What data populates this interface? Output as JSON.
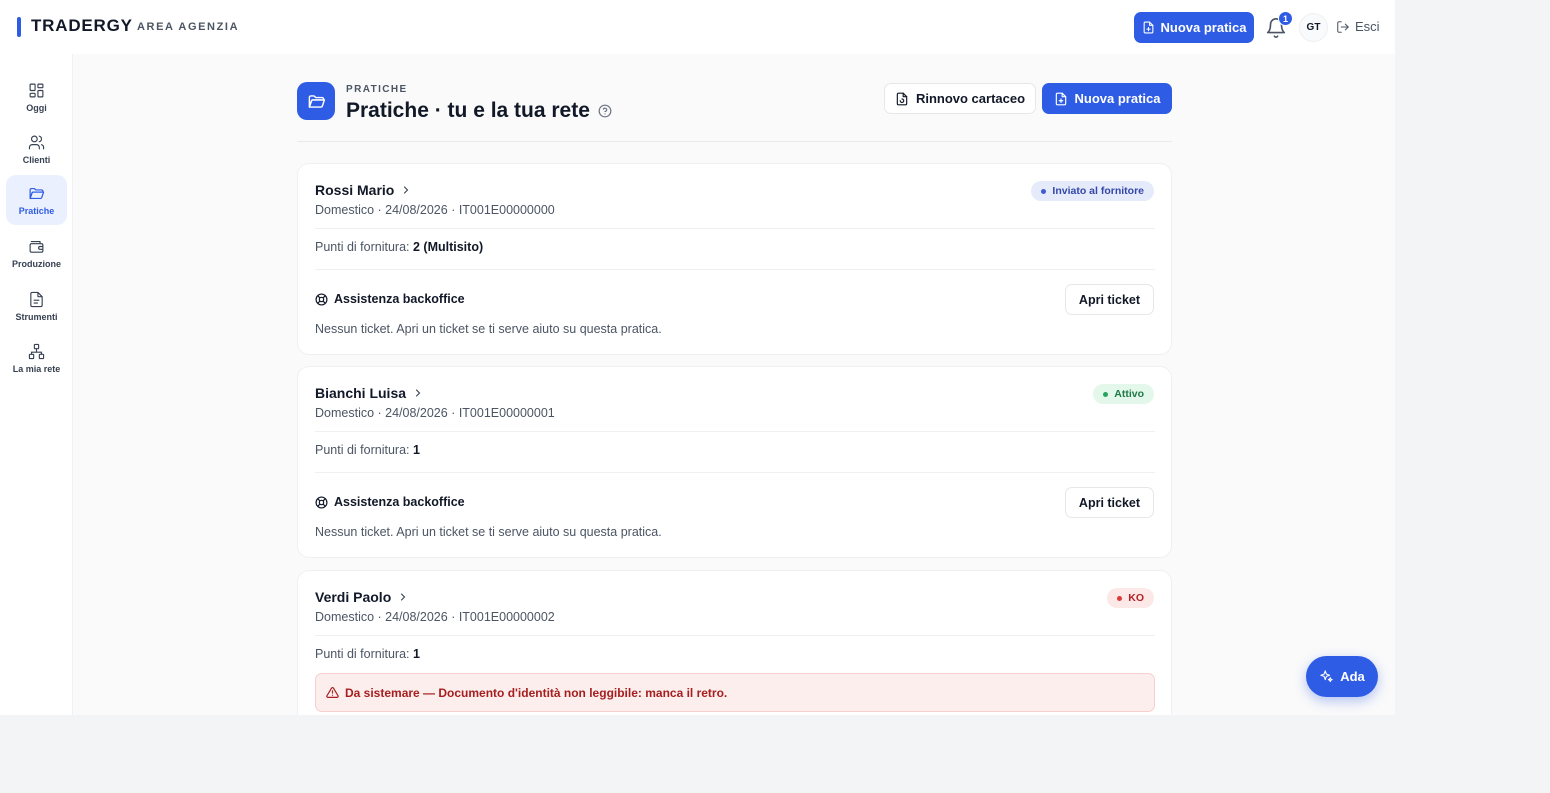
{
  "header": {
    "brand": "TRADERGY",
    "area": "AREA AGENZIA",
    "new_button": "Nuova pratica",
    "notif_count": "1",
    "avatar": "GT",
    "logout": "Esci"
  },
  "sidebar": {
    "items": [
      {
        "label": "Oggi",
        "icon": "grid-icon"
      },
      {
        "label": "Clienti",
        "icon": "users-icon"
      },
      {
        "label": "Pratiche",
        "icon": "folder-icon",
        "active": true
      },
      {
        "label": "Produzione",
        "icon": "wallet-icon"
      },
      {
        "label": "Strumenti",
        "icon": "document-icon"
      },
      {
        "label": "La mia rete",
        "icon": "network-icon"
      }
    ]
  },
  "page": {
    "eyebrow": "PRATICHE",
    "title": "Pratiche · tu e la tua rete",
    "btn_renew": "Rinnovo cartaceo",
    "btn_new": "Nuova pratica"
  },
  "cards": [
    {
      "name": "Rossi Mario",
      "meta": "Domestico · 24/08/2026 · IT001E00000000",
      "status": "Inviato al fornitore",
      "punti_label": "Punti di fornitura:",
      "punti_value": "2 (Multisito)",
      "assist": "Assistenza backoffice",
      "ticket_btn": "Apri ticket",
      "no_ticket": "Nessun ticket. Apri un ticket se ti serve aiuto su questa pratica."
    },
    {
      "name": "Bianchi Luisa",
      "meta": "Domestico · 24/08/2026 · IT001E00000001",
      "status": "Attivo",
      "punti_label": "Punti di fornitura:",
      "punti_value": "1",
      "assist": "Assistenza backoffice",
      "ticket_btn": "Apri ticket",
      "no_ticket": "Nessun ticket. Apri un ticket se ti serve aiuto su questa pratica."
    },
    {
      "name": "Verdi Paolo",
      "meta": "Domestico · 24/08/2026 · IT001E00000002",
      "status": "KO",
      "punti_label": "Punti di fornitura:",
      "punti_value": "1",
      "alert": "Da sistemare — Documento d'identità non leggibile: manca il retro."
    }
  ],
  "fab": {
    "label": "Ada"
  },
  "colors": {
    "accent": "#2f5ce4",
    "status_blue": "#3f5bd6",
    "status_green": "#27a45d",
    "status_red": "#dc3b3b"
  }
}
